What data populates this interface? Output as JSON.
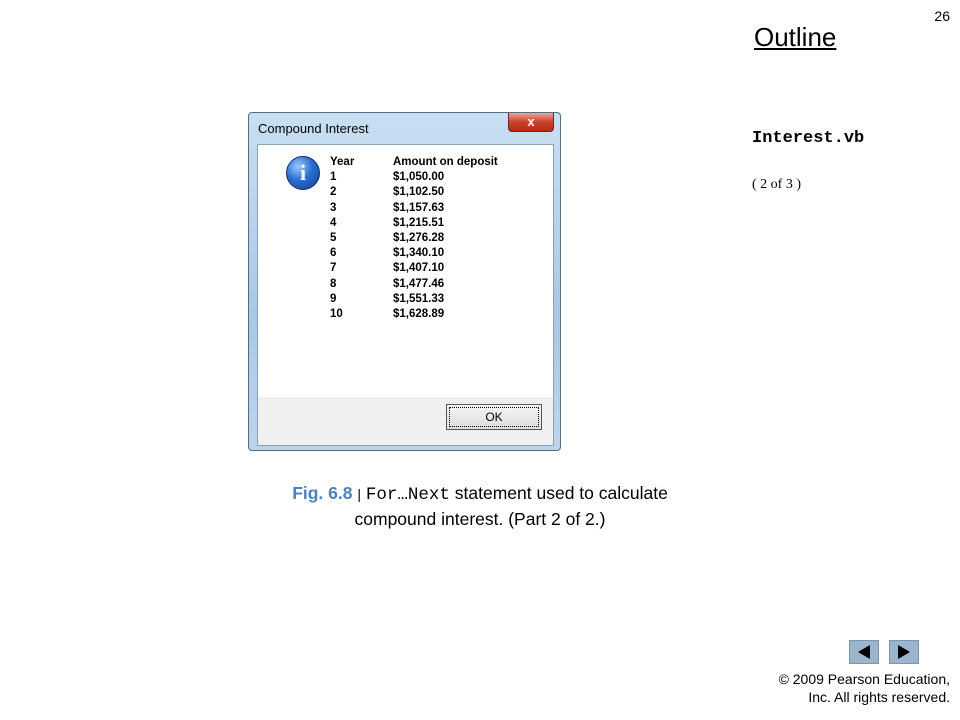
{
  "page": {
    "number": "26",
    "outline_title": "Outline",
    "file_name": "Interest.vb",
    "part_label": "( 2 of 3 )"
  },
  "dialog": {
    "title": "Compound Interest",
    "close_label": "x",
    "icon": "information-icon",
    "headers": {
      "year": "Year",
      "amount": "Amount on deposit"
    },
    "rows": [
      {
        "year": "1",
        "amount": "$1,050.00"
      },
      {
        "year": "2",
        "amount": "$1,102.50"
      },
      {
        "year": "3",
        "amount": "$1,157.63"
      },
      {
        "year": "4",
        "amount": "$1,215.51"
      },
      {
        "year": "5",
        "amount": "$1,276.28"
      },
      {
        "year": "6",
        "amount": "$1,340.10"
      },
      {
        "year": "7",
        "amount": "$1,407.10"
      },
      {
        "year": "8",
        "amount": "$1,477.46"
      },
      {
        "year": "9",
        "amount": "$1,551.33"
      },
      {
        "year": "10",
        "amount": "$1,628.89"
      }
    ],
    "ok_label": "OK"
  },
  "caption": {
    "fig_label": "Fig. 6.8",
    "separator": "|",
    "code": "For…Next",
    "text_line1": "statement used to calculate",
    "text_line2": "compound interest. (Part 2 of 2.)"
  },
  "nav": {
    "prev_icon": "triangle-left-icon",
    "next_icon": "triangle-right-icon"
  },
  "footer": {
    "copyright_line1": "© 2009 Pearson Education,",
    "copyright_line2": "Inc.  All rights reserved."
  },
  "colors": {
    "fig_label": "#4f81bd",
    "nav_button": "#9bb6cc"
  }
}
